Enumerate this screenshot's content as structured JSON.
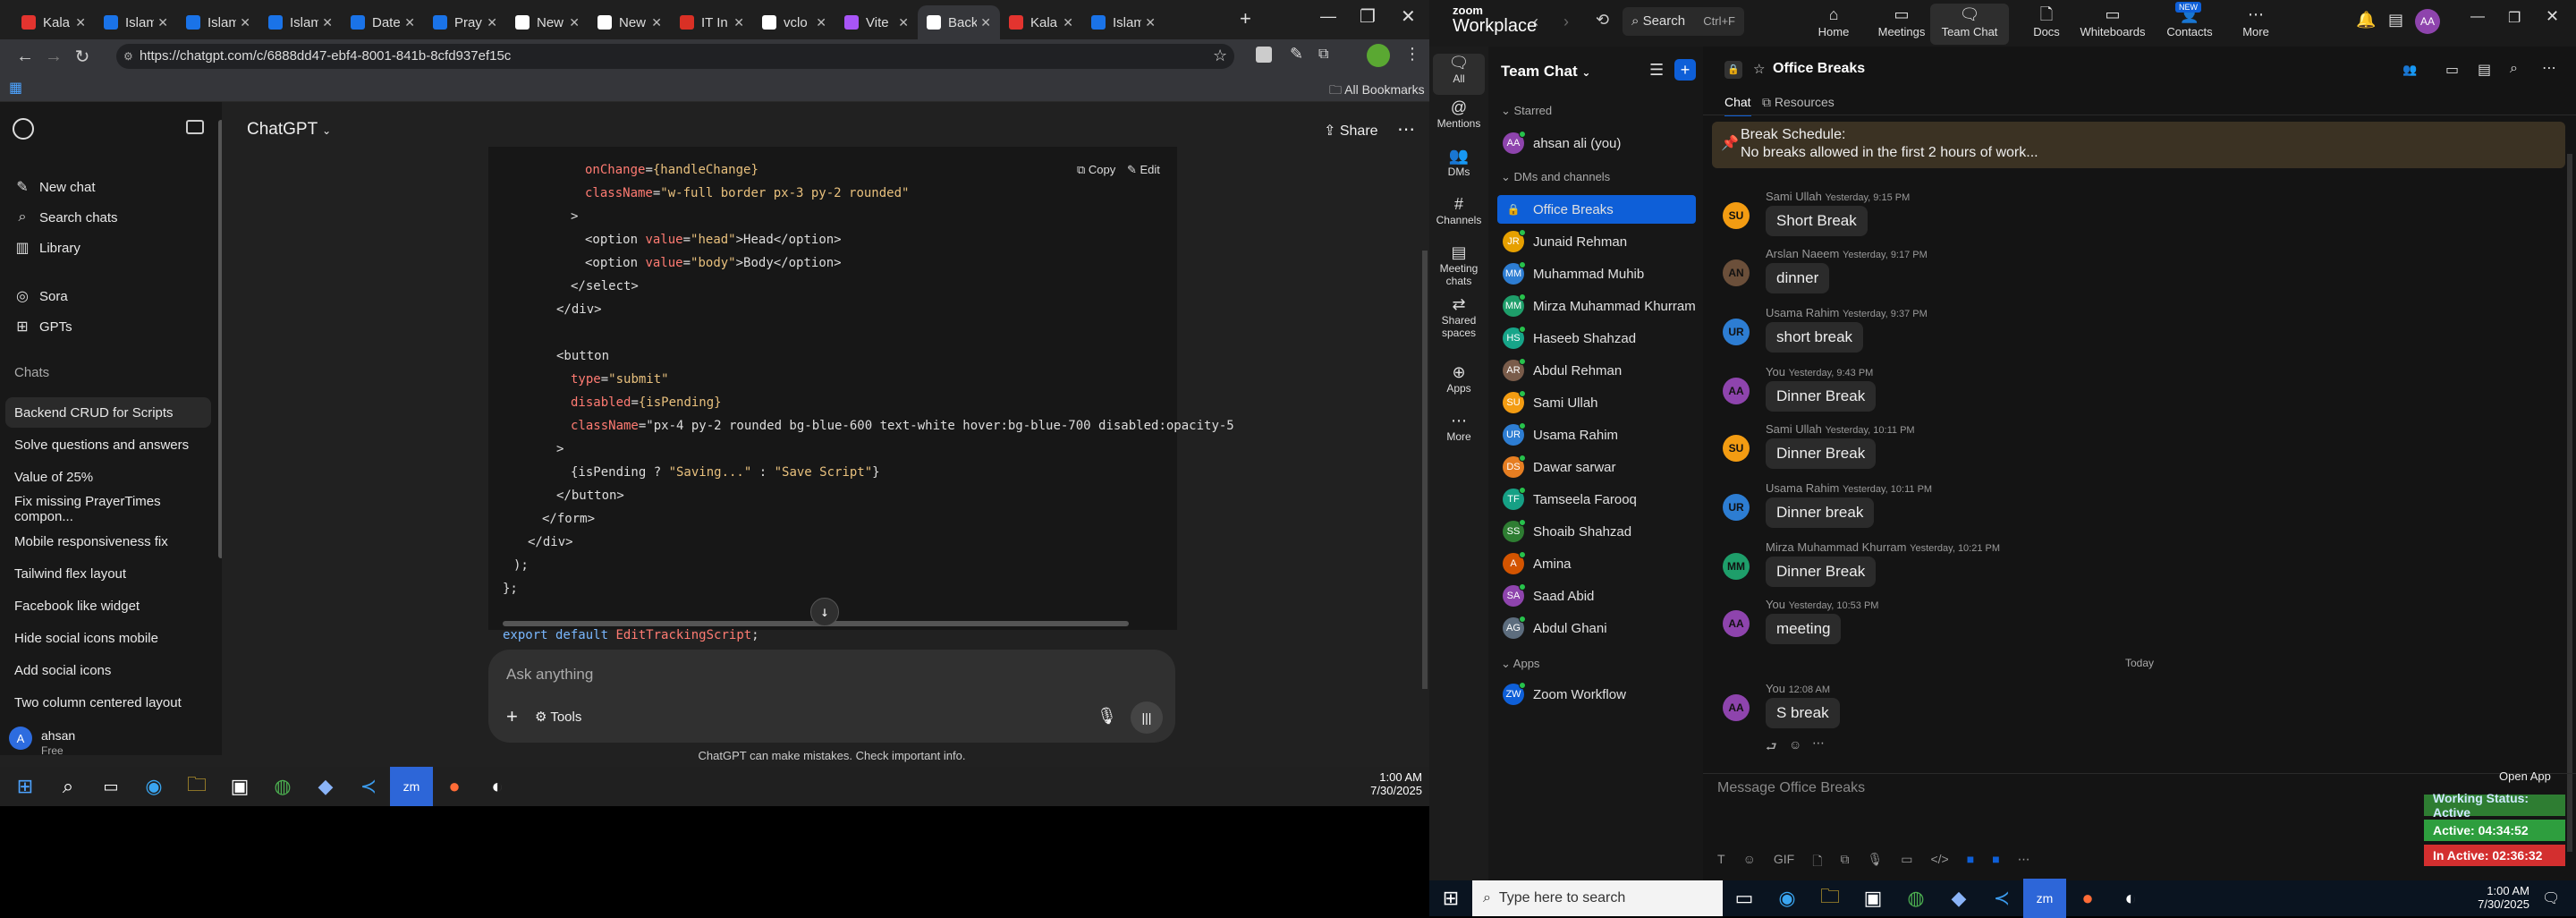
{
  "browser": {
    "tabs": [
      {
        "label": "Kala",
        "color": "#e3342f"
      },
      {
        "label": "Islam",
        "color": "#1a73e8"
      },
      {
        "label": "Islam",
        "color": "#1a73e8"
      },
      {
        "label": "Islam",
        "color": "#1a73e8"
      },
      {
        "label": "Date",
        "color": "#1a73e8"
      },
      {
        "label": "Pray",
        "color": "#1a73e8"
      },
      {
        "label": "New",
        "color": "#ffffff"
      },
      {
        "label": "New",
        "color": "#ffffff"
      },
      {
        "label": "IT In",
        "color": "#d93025"
      },
      {
        "label": "vclo",
        "color": "#ffffff"
      },
      {
        "label": "Vite",
        "color": "#a855f7"
      },
      {
        "label": "Back",
        "color": "#ffffff"
      },
      {
        "label": "Kala",
        "color": "#e3342f"
      },
      {
        "label": "Islam",
        "color": "#1a73e8"
      }
    ],
    "url": "https://chatgpt.com/c/6888dd47-ebf4-8001-841b-8cfd937ef15c",
    "all_bookmarks": "All Bookmarks"
  },
  "gpt": {
    "title": "ChatGPT",
    "share": "Share",
    "nav": [
      {
        "label": "New chat",
        "icon": "edit-icon"
      },
      {
        "label": "Search chats",
        "icon": "search-icon"
      },
      {
        "label": "Library",
        "icon": "library-icon"
      },
      {
        "label": "Sora",
        "icon": "sora-icon"
      },
      {
        "label": "GPTs",
        "icon": "gpts-icon"
      }
    ],
    "chats_header": "Chats",
    "chats": [
      "Backend CRUD for Scripts",
      "Solve questions and answers",
      "Value of 25%",
      "Fix missing PrayerTimes compon...",
      "Mobile responsiveness fix",
      "Tailwind flex layout",
      "Facebook like widget",
      "Hide social icons mobile",
      "Add social icons",
      "Two column centered layout"
    ],
    "user_name": "ahsan",
    "user_plan": "Free",
    "copy": "Copy",
    "edit": "Edit",
    "placeholder": "Ask anything",
    "tools": "Tools",
    "disclaimer": "ChatGPT can make mistakes. Check important info."
  },
  "code_lines": [
    "onChange={handleChange}",
    "className=\"w-full border px-3 py-2 rounded\"",
    ">",
    "<option value=\"head\">Head</option>",
    "<option value=\"body\">Body</option>",
    "</select>",
    "</div>",
    "",
    "<button",
    "type=\"submit\"",
    "disabled={isPending}",
    "className=\"px-4 py-2 rounded bg-blue-600 text-white hover:bg-blue-700 disabled:opacity-5",
    ">",
    "{isPending ? \"Saving...\" : \"Save Script\"}",
    "</button>",
    "</form>",
    "</div>",
    ");",
    "};",
    "",
    "export default EditTrackingScript;"
  ],
  "win_taskbar": {
    "time": "1:00 AM",
    "date": "7/30/2025"
  },
  "zoom": {
    "brand_top": "zoom",
    "brand": "Workplace",
    "search": "Search",
    "search_shortcut": "Ctrl+F",
    "nav": [
      {
        "label": "Home",
        "icon": "home-icon"
      },
      {
        "label": "Meetings",
        "icon": "meetings-icon"
      },
      {
        "label": "Team Chat",
        "icon": "team-chat-icon"
      },
      {
        "label": "Docs",
        "icon": "docs-icon"
      },
      {
        "label": "Whiteboards",
        "icon": "whiteboards-icon"
      },
      {
        "label": "Contacts",
        "icon": "contacts-icon"
      },
      {
        "label": "More",
        "icon": "more-icon"
      }
    ],
    "new_badge": "NEW",
    "user_initials": "AA",
    "rail": [
      {
        "label": "All",
        "icon": "chat-bubble-icon"
      },
      {
        "label": "Mentions",
        "icon": "at-icon"
      },
      {
        "label": "DMs",
        "icon": "dm-icon"
      },
      {
        "label": "Channels",
        "icon": "hash-icon"
      },
      {
        "label": "Meeting chats",
        "icon": "calendar-icon"
      },
      {
        "label": "Shared spaces",
        "icon": "shared-icon"
      },
      {
        "label": "Apps",
        "icon": "apps-icon"
      },
      {
        "label": "More",
        "icon": "more-dots-icon"
      }
    ],
    "list_title": "Team Chat",
    "starred_header": "Starred",
    "starred": [
      {
        "name": "ahsan ali (you)",
        "initials": "AA",
        "color": "#8e44ad"
      }
    ],
    "dm_header": "DMs and channels",
    "dms": [
      {
        "name": "Office Breaks",
        "initials": "",
        "color": "#0e5fd8"
      },
      {
        "name": "Junaid Rehman",
        "initials": "JR",
        "color": "#e6a000"
      },
      {
        "name": "Muhammad Muhib",
        "initials": "MM",
        "color": "#2d7dd2"
      },
      {
        "name": "Mirza Muhammad Khurram",
        "initials": "MM",
        "color": "#1e9e6a"
      },
      {
        "name": "Haseeb Shahzad",
        "initials": "HS",
        "color": "#17a589"
      },
      {
        "name": "Abdul Rehman",
        "initials": "AR",
        "color": "#7a5c4a"
      },
      {
        "name": "Sami Ullah",
        "initials": "SU",
        "color": "#f39c12"
      },
      {
        "name": "Usama Rahim",
        "initials": "UR",
        "color": "#2d7dd2"
      },
      {
        "name": "Dawar sarwar",
        "initials": "DS",
        "color": "#e67e22"
      },
      {
        "name": "Tamseela Farooq",
        "initials": "TF",
        "color": "#16a085"
      },
      {
        "name": "Shoaib Shahzad",
        "initials": "SS",
        "color": "#2e7d32"
      },
      {
        "name": "Amina",
        "initials": "A",
        "color": "#d35400"
      },
      {
        "name": "Saad Abid",
        "initials": "SA",
        "color": "#8e44ad"
      },
      {
        "name": "Abdul Ghani",
        "initials": "AG",
        "color": "#5d6d7e"
      }
    ],
    "apps_header": "Apps",
    "apps": [
      {
        "name": "Zoom Workflow",
        "initials": "ZW",
        "color": "#0e5fd8"
      }
    ],
    "channel_name": "Office Breaks",
    "tab_chat": "Chat",
    "tab_resources": "Resources",
    "pin_title": "Break Schedule:",
    "pin_text": "No breaks allowed in the first 2 hours of work...",
    "messages": [
      {
        "initials": "SU",
        "color": "#f39c12",
        "author": "Sami Ullah",
        "time": "Yesterday, 9:15 PM",
        "text": "Short Break"
      },
      {
        "initials": "AN",
        "color": "#6b4f3a",
        "author": "Arslan Naeem",
        "time": "Yesterday, 9:17 PM",
        "text": "dinner"
      },
      {
        "initials": "UR",
        "color": "#2d7dd2",
        "author": "Usama Rahim",
        "time": "Yesterday, 9:37 PM",
        "text": "short break"
      },
      {
        "initials": "AA",
        "color": "#8e44ad",
        "author": "You",
        "time": "Yesterday, 9:43 PM",
        "text": "Dinner Break"
      },
      {
        "initials": "SU",
        "color": "#f39c12",
        "author": "Sami Ullah",
        "time": "Yesterday, 10:11 PM",
        "text": "Dinner Break"
      },
      {
        "initials": "UR",
        "color": "#2d7dd2",
        "author": "Usama Rahim",
        "time": "Yesterday, 10:11 PM",
        "text": "Dinner break"
      },
      {
        "initials": "MM",
        "color": "#1e9e6a",
        "author": "Mirza Muhammad Khurram",
        "time": "Yesterday, 10:21 PM",
        "text": "Dinner Break"
      },
      {
        "initials": "AA",
        "color": "#8e44ad",
        "author": "You",
        "time": "Yesterday, 10:53 PM",
        "text": "meeting"
      },
      {
        "initials": "AA",
        "color": "#8e44ad",
        "author": "You",
        "time": "12:08 AM",
        "text": "S break"
      }
    ],
    "today_label": "Today",
    "input_placeholder": "Message Office Breaks",
    "open_app": "Open App",
    "status_working": "Working Status: Active",
    "status_active": "Active: 04:34:52",
    "status_inactive": "In Active: 02:36:32",
    "taskbar_search": "Type here to search"
  }
}
